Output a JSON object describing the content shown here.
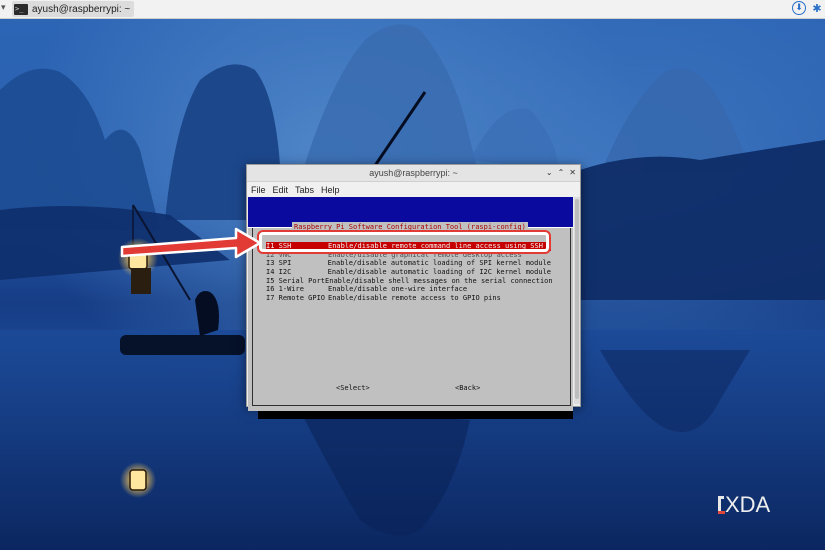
{
  "taskbar": {
    "menu_glyph": "▾",
    "task_label": "ayush@raspberrypi: ~",
    "term_glyph": ">_",
    "download_glyph": "⬇",
    "bluetooth_glyph": "✱"
  },
  "terminal": {
    "title": "ayush@raspberrypi: ~",
    "controls": [
      "⌄",
      "⌃",
      "✕"
    ],
    "menu": [
      "File",
      "Edit",
      "Tabs",
      "Help"
    ]
  },
  "raspi_config": {
    "title": "Raspberry Pi Software Configuration Tool (raspi-config)",
    "options": [
      {
        "code": "I1 SSH",
        "desc": "Enable/disable remote command line access using SSH",
        "selected": true
      },
      {
        "code": "I2 VNC",
        "desc": "Enable/disable graphical remote desktop access",
        "selected": false,
        "obscured": true
      },
      {
        "code": "I3 SPI",
        "desc": "Enable/disable automatic loading of SPI kernel module",
        "selected": false
      },
      {
        "code": "I4 I2C",
        "desc": "Enable/disable automatic loading of I2C kernel module",
        "selected": false
      },
      {
        "code": "I5 Serial Port",
        "desc": "Enable/disable shell messages on the serial connection",
        "selected": false
      },
      {
        "code": "I6 1-Wire",
        "desc": "Enable/disable one-wire interface",
        "selected": false
      },
      {
        "code": "I7 Remote GPIO",
        "desc": "Enable/disable remote access to GPIO pins",
        "selected": false
      }
    ],
    "select_button": "<Select>",
    "back_button": "<Back>"
  },
  "watermark": {
    "brand": "XDA"
  },
  "colors": {
    "annotation": "#e23b35",
    "selection": "#c60000",
    "terminal_bg": "#0a0a9e",
    "dialog_bg": "#c0c0c0",
    "title_red": "#a80000"
  }
}
